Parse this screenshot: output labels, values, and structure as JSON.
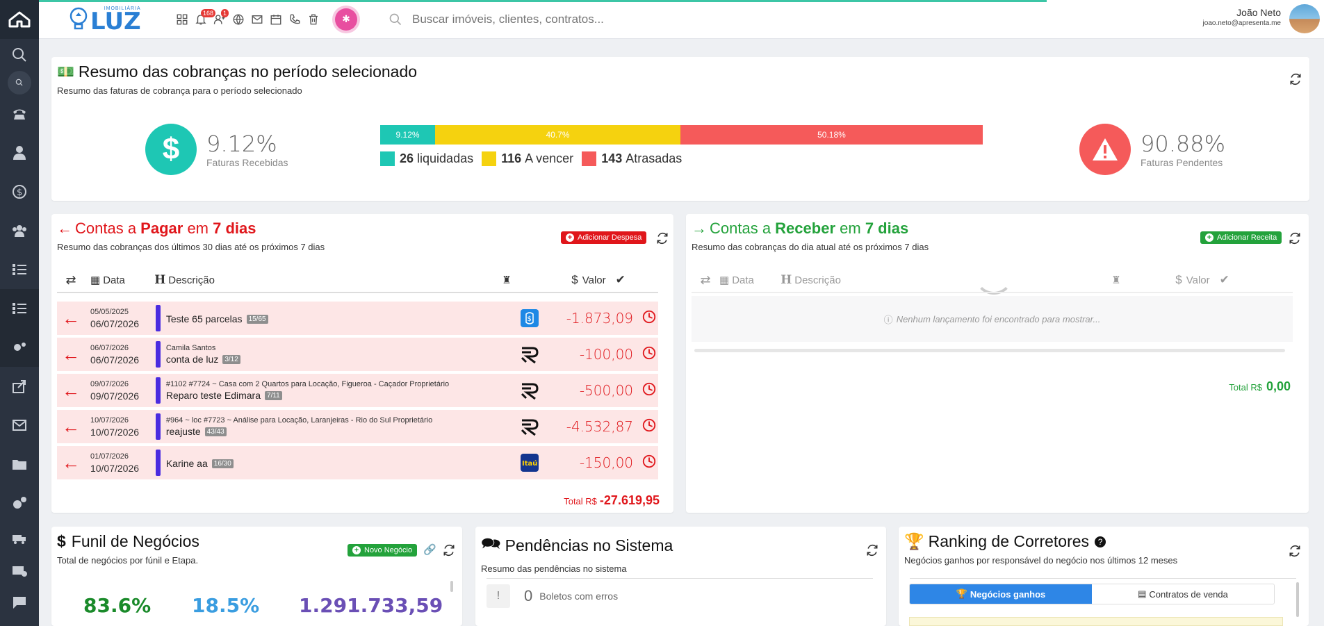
{
  "topbar": {
    "brand_small": "IMOBILIÁRIA",
    "brand": "LUZ",
    "notif_badge": "168",
    "users_badge": "1",
    "search_placeholder": "Buscar imóveis, clientes, contratos...",
    "user_name": "João Neto",
    "user_email": "joao.neto@apresenta.me"
  },
  "summary": {
    "title": "Resumo das cobranças no período selecionado",
    "subtitle": "Resumo das faturas de cobrança para o período selecionado",
    "received_pct": "9.12%",
    "received_label": "Faturas Recebidas",
    "pending_pct": "90.88%",
    "pending_label": "Faturas Pendentes",
    "segments": [
      {
        "label": "9.12%",
        "value": 9.12,
        "color": "#1ec7b4"
      },
      {
        "label": "40.7%",
        "value": 40.7,
        "color": "#f5d20f"
      },
      {
        "label": "50.18%",
        "value": 50.18,
        "color": "#f55a5a"
      }
    ],
    "legend": [
      {
        "count": "26",
        "label": "liquidadas",
        "color": "#1ec7b4"
      },
      {
        "count": "116",
        "label": "A vencer",
        "color": "#f5d20f"
      },
      {
        "count": "143",
        "label": "Atrasadas",
        "color": "#f55a5a"
      }
    ]
  },
  "pagar": {
    "title_a": "Contas a ",
    "title_b": "Pagar",
    "title_c": " em ",
    "title_d": "7 dias",
    "subtitle": "Resumo das cobranças dos últimos 30 dias até os próximos 7 dias",
    "add_button": "Adicionar Despesa",
    "col_data": "Data",
    "col_desc": "Descrição",
    "col_valor": "Valor",
    "total_label": "Total R$",
    "total_value": "-27.619,95",
    "rows": [
      {
        "d1": "05/05/2025",
        "d2": "06/07/2026",
        "meta": "",
        "title": "Teste 65 parcelas",
        "tag": "15/65",
        "bank": "bank-blue",
        "value": "-1.873,09"
      },
      {
        "d1": "06/07/2026",
        "d2": "06/07/2026",
        "meta": "Camila Santos",
        "title": "conta de luz",
        "tag": "3/12",
        "bank": "bank-r",
        "value": "-100,00"
      },
      {
        "d1": "09/07/2026",
        "d2": "09/07/2026",
        "meta": "#1102  #7724 ~ Casa com 2 Quartos para Locação, Figueroa - Caçador  Proprietário",
        "title": "Reparo teste Edimara",
        "tag": "7/11",
        "bank": "bank-r",
        "value": "-500,00"
      },
      {
        "d1": "10/07/2026",
        "d2": "10/07/2026",
        "meta": "#964 ~ loc  #7723 ~ Análise para Locação, Laranjeiras - Rio do Sul  Proprietário",
        "title": "reajuste",
        "tag": "43/43",
        "bank": "bank-r",
        "value": "-4.532,87"
      },
      {
        "d1": "01/07/2026",
        "d2": "10/07/2026",
        "meta": "",
        "title": "Karine aa",
        "tag": "16/30",
        "bank": "bank-itau",
        "value": "-150,00"
      }
    ]
  },
  "receber": {
    "title_a": "Contas a ",
    "title_b": "Receber",
    "title_c": " em ",
    "title_d": "7 dias",
    "subtitle": "Resumo das cobranças do dia atual até os próximos 7 dias",
    "add_button": "Adicionar Receita",
    "col_data": "Data",
    "col_desc": "Descrição",
    "col_valor": "Valor",
    "empty": "Nenhum lançamento foi encontrado para mostrar...",
    "total_label": "Total R$",
    "total_value": "0,00"
  },
  "funil": {
    "title": "Funil de Negócios",
    "subtitle": "Total de negócios por fúnil e Etapa.",
    "button": "Novo Negócio",
    "kpi1": "83.6%",
    "kpi2": "18.5%",
    "kpi3": "1.291.733,59"
  },
  "pendencias": {
    "title": "Pendências no Sistema",
    "subtitle": "Resumo das pendências no sistema",
    "item_count": "0",
    "item_label": "Boletos com erros"
  },
  "ranking": {
    "title": "Ranking de Corretores",
    "subtitle": "Negócios ganhos por responsável do negócio nos últimos 12 meses",
    "tab1": "Negócios ganhos",
    "tab2": "Contratos de venda"
  }
}
